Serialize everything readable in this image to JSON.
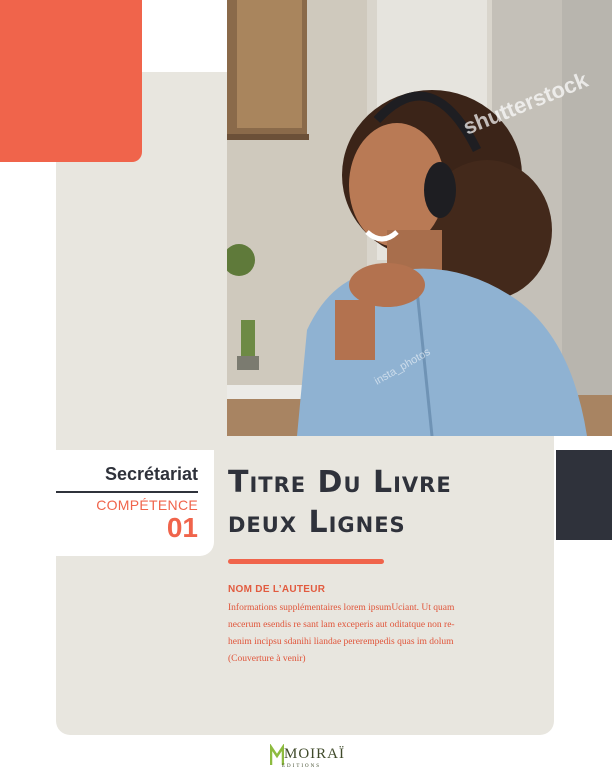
{
  "cover": {
    "series": "Secrétariat",
    "competence_label": "COMPÉTENCE",
    "competence_number": "01",
    "title_lines": [
      "Titre Du Livre",
      "deux Lignes"
    ],
    "author": "NOM DE L’AUTEUR",
    "description_lines": [
      "Informations supplémentaires lorem ipsumUciant. Ut quam",
      "necerum esendis re sant lam exceperis aut oditatque non re-",
      "henim incipsu sdanihi liandae pererempedis quas im dolum",
      "(Couverture à venir)"
    ]
  },
  "photo": {
    "watermark": "shutterstock",
    "watermark_small": "insta_photos"
  },
  "publisher": {
    "logo": "MOIRAÏ",
    "sub": "EDITIONS"
  },
  "colors": {
    "accent": "#f0644b",
    "dark": "#2f323b",
    "beige": "#e8e6df"
  }
}
